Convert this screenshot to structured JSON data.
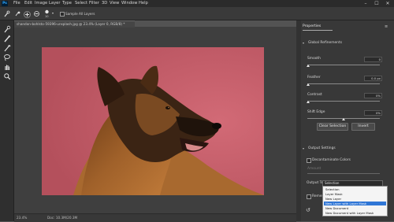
{
  "app": {
    "logo": "Ps"
  },
  "menubar": {
    "items": [
      "File",
      "Edit",
      "Image",
      "Layer",
      "Type",
      "Select",
      "Filter",
      "3D",
      "View",
      "Window",
      "Help"
    ],
    "window_controls": [
      "–",
      "☐",
      "✕"
    ]
  },
  "options_bar": {
    "brush_size": "10",
    "sample_all_layers_label": "Sample All Layers"
  },
  "document": {
    "tab_title": "shandon-bohlsto-59396-unsplash.jpg @ 23.4% (Layer 0, RGB/8) *",
    "status_zoom": "23.4%",
    "status_doc": "Doc: 10.3M/20.3M"
  },
  "properties_panel": {
    "tab_label": "Properties",
    "global_refinements_label": "Global Refinements",
    "smooth_label": "Smooth",
    "smooth_value": "0",
    "feather_label": "Feather",
    "feather_value": "0.0 px",
    "contrast_label": "Contrast",
    "contrast_value": "0%",
    "shift_edge_label": "Shift Edge",
    "shift_edge_value": "0%",
    "clear_selection_label": "Clear Selection",
    "invert_label": "Invert",
    "output_settings_label": "Output Settings",
    "decontaminate_label": "Decontaminate Colors",
    "amount_label": "Amount",
    "output_to_label": "Output To",
    "output_to_value": "Selection",
    "remember_label": "Remember"
  },
  "output_dropdown": {
    "options": [
      "Selection",
      "Layer Mask",
      "New Layer",
      "New Layer with Layer Mask",
      "New Document",
      "New Document with Layer Mask"
    ],
    "highlighted_index": 3
  },
  "colors": {
    "photo_background": "#c75a68",
    "highlight": "#2f76d6"
  }
}
